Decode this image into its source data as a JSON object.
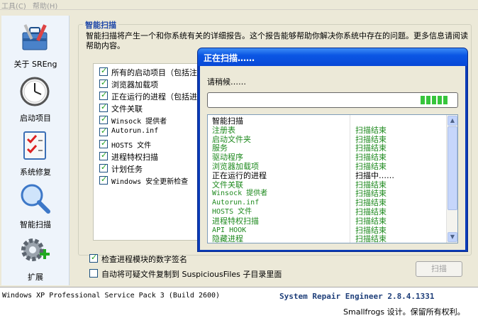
{
  "menu": {
    "tools": "工具(C)",
    "help": "帮助(H)"
  },
  "sidebar": {
    "items": [
      {
        "label": "关于 SREng",
        "icon": "toolbox-icon"
      },
      {
        "label": "启动项目",
        "icon": "clock-icon"
      },
      {
        "label": "系统修复",
        "icon": "checklist-icon"
      },
      {
        "label": "智能扫描",
        "icon": "magnifier-icon"
      },
      {
        "label": "扩展",
        "icon": "gear-plus-icon"
      }
    ]
  },
  "main": {
    "group_title": "智能扫描",
    "description": "智能扫描将产生一个和你系统有关的详细报告。这个报告能够帮助你解决你系统中存在的问题。更多信息请阅读帮助内容。",
    "options": [
      {
        "label": "所有的启动项目（包括注",
        "checked": true
      },
      {
        "label": "浏览器加载项",
        "checked": true
      },
      {
        "label": "正在运行的进程（包括进",
        "checked": true
      },
      {
        "label": "文件关联",
        "checked": true
      },
      {
        "label": "Winsock 提供者",
        "checked": true
      },
      {
        "label": "Autorun.inf",
        "checked": true
      },
      {
        "label": "HOSTS 文件",
        "checked": true
      },
      {
        "label": "进程特权扫描",
        "checked": true
      },
      {
        "label": "计划任务",
        "checked": true
      },
      {
        "label": "Windows 安全更新检查",
        "checked": true
      }
    ],
    "check_signature": "检查进程模块的数字签名",
    "auto_copy": "自动将可疑文件复制到 SuspiciousFiles 子目录里面",
    "scan_button": "扫描"
  },
  "dialog": {
    "title": "正在扫描……",
    "wait_text": "请稍候……",
    "progress_percent": 0.12,
    "rows": [
      {
        "name": "智能扫描",
        "status": "",
        "color": "#000000"
      },
      {
        "name": "注册表",
        "status": "扫描结束",
        "color": "#1f8a1f"
      },
      {
        "name": "启动文件夹",
        "status": "扫描结束",
        "color": "#1f8a1f"
      },
      {
        "name": "服务",
        "status": "扫描结束",
        "color": "#1f8a1f"
      },
      {
        "name": "驱动程序",
        "status": "扫描结束",
        "color": "#1f8a1f"
      },
      {
        "name": "浏览器加载项",
        "status": "扫描结束",
        "color": "#1f8a1f"
      },
      {
        "name": "正在运行的进程",
        "status": "扫描中……",
        "color": "#000000"
      },
      {
        "name": "文件关联",
        "status": "扫描结束",
        "color": "#1f8a1f"
      },
      {
        "name": "Winsock 提供者",
        "status": "扫描结束",
        "color": "#1f8a1f"
      },
      {
        "name": "Autorun.inf",
        "status": "扫描结束",
        "color": "#1f8a1f"
      },
      {
        "name": "HOSTS 文件",
        "status": "扫描结束",
        "color": "#1f8a1f"
      },
      {
        "name": "进程特权扫描",
        "status": "扫描结束",
        "color": "#1f8a1f"
      },
      {
        "name": "API HOOK",
        "status": "扫描结束",
        "color": "#1f8a1f"
      },
      {
        "name": "隐藏进程",
        "status": "扫描结束",
        "color": "#1f8a1f"
      }
    ]
  },
  "status": {
    "os": "Windows XP Professional Service Pack 3 (Build 2600)",
    "product": "System Repair Engineer 2.8.4.1331",
    "copyright": "Smallfrogs 设计。保留所有权利。"
  },
  "colors": {
    "accent": "#0b56e4",
    "status_done": "#1f8a1f",
    "group_title": "#1d46a8"
  }
}
